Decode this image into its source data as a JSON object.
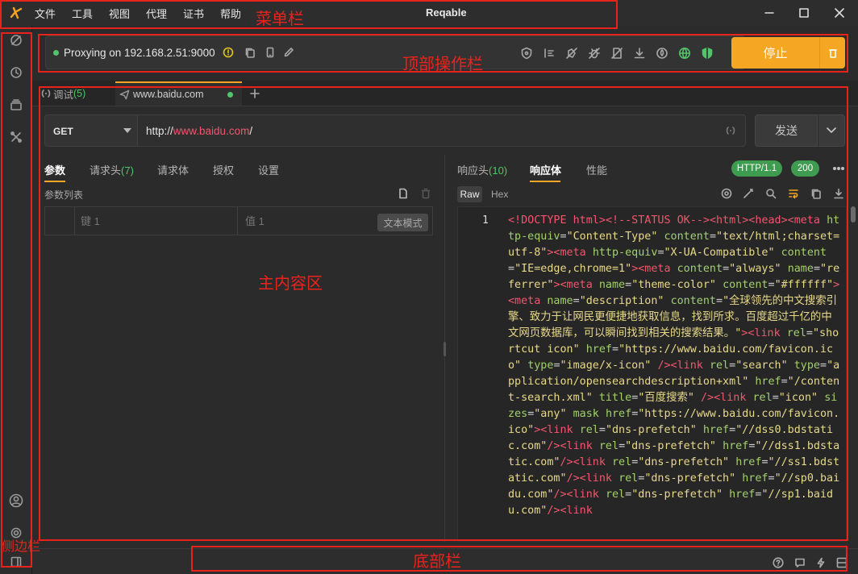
{
  "window": {
    "title": "Reqable",
    "controls": [
      "minimize",
      "maximize",
      "close"
    ]
  },
  "menu": [
    "文件",
    "工具",
    "视图",
    "代理",
    "证书",
    "帮助"
  ],
  "proxy": {
    "status_text": "Proxying on 192.168.2.51:9000",
    "status_color": "#52c46a"
  },
  "toolbar_icons": [
    "shield-icon",
    "breakpoint-icon",
    "no-cache-icon",
    "debug-icon",
    "rewrite-icon",
    "download-icon",
    "script-icon",
    "globe-icon",
    "secure-shield-icon"
  ],
  "stop_button": {
    "label": "停止",
    "color": "#f5a623"
  },
  "tabs": [
    {
      "label": "调试",
      "count": "(5)"
    },
    {
      "label": "www.baidu.com",
      "active": true
    }
  ],
  "request": {
    "method": "GET",
    "url_prefix": "http://",
    "url_host": "www.baidu.com",
    "url_suffix": "/",
    "send_label": "发送"
  },
  "request_tabs": [
    {
      "label": "参数",
      "active": true
    },
    {
      "label": "请求头",
      "count": "(7)"
    },
    {
      "label": "请求体"
    },
    {
      "label": "授权"
    },
    {
      "label": "设置"
    }
  ],
  "params": {
    "title": "参数列表",
    "key_placeholder": "键 1",
    "value_placeholder": "值 1",
    "text_mode_label": "文本模式"
  },
  "response_tabs": [
    {
      "label": "响应头",
      "count": "(10)"
    },
    {
      "label": "响应体",
      "active": true
    },
    {
      "label": "性能"
    }
  ],
  "response_badges": {
    "protocol": "HTTP/1.1",
    "status": "200",
    "color": "#3f9b4f"
  },
  "view_modes": [
    "Raw",
    "Hex"
  ],
  "code": {
    "line_number": "1",
    "segments": [
      [
        "tg",
        "<!DOCTYPE html>"
      ],
      [
        "tg",
        "<!--STATUS OK-->"
      ],
      [
        "tg",
        "<html><head><meta "
      ],
      [
        "at",
        "http-equiv"
      ],
      [
        "",
        "="
      ],
      [
        "st",
        "\"Content-Type\" "
      ],
      [
        "at",
        "content"
      ],
      [
        "",
        "="
      ],
      [
        "st",
        "\"text/html;charset=utf-8\""
      ],
      [
        "tg",
        "><meta "
      ],
      [
        "at",
        "http-equiv"
      ],
      [
        "",
        "="
      ],
      [
        "st",
        "\"X-UA-Compatible\" "
      ],
      [
        "at",
        "content"
      ],
      [
        "",
        "="
      ],
      [
        "st",
        "\"IE=edge,chrome=1\""
      ],
      [
        "tg",
        "><meta "
      ],
      [
        "at",
        "content"
      ],
      [
        "",
        "="
      ],
      [
        "st",
        "\"always\" "
      ],
      [
        "at",
        "name"
      ],
      [
        "",
        "="
      ],
      [
        "st",
        "\"referrer\""
      ],
      [
        "tg",
        "><meta "
      ],
      [
        "at",
        "name"
      ],
      [
        "",
        "="
      ],
      [
        "st",
        "\"theme-color\" "
      ],
      [
        "at",
        "content"
      ],
      [
        "",
        "="
      ],
      [
        "st",
        "\"#ffffff\""
      ],
      [
        "tg",
        "><meta "
      ],
      [
        "at",
        "name"
      ],
      [
        "",
        "="
      ],
      [
        "st",
        "\"description\" "
      ],
      [
        "at",
        "content"
      ],
      [
        "",
        "="
      ],
      [
        "st",
        "\"全球领先的中文搜索引擎、致力于让网民更便捷地获取信息，找到所求。百度超过千亿的中文网页数据库，可以瞬间找到相关的搜索结果。\""
      ],
      [
        "tg",
        "><link "
      ],
      [
        "at",
        "rel"
      ],
      [
        "",
        "="
      ],
      [
        "st",
        "\"shortcut icon\" "
      ],
      [
        "at",
        "href"
      ],
      [
        "",
        "="
      ],
      [
        "st",
        "\"https://www.baidu.com/favicon.ico\" "
      ],
      [
        "at",
        "type"
      ],
      [
        "",
        "="
      ],
      [
        "st",
        "\"image/x-icon\" "
      ],
      [
        "tg",
        "/><link "
      ],
      [
        "at",
        "rel"
      ],
      [
        "",
        "="
      ],
      [
        "st",
        "\"search\" "
      ],
      [
        "at",
        "type"
      ],
      [
        "",
        "="
      ],
      [
        "st",
        "\"application/opensearchdescription+xml\" "
      ],
      [
        "at",
        "href"
      ],
      [
        "",
        "="
      ],
      [
        "st",
        "\"/content-search.xml\" "
      ],
      [
        "at",
        "title"
      ],
      [
        "",
        "="
      ],
      [
        "st",
        "\"百度搜索\" "
      ],
      [
        "tg",
        "/><link "
      ],
      [
        "at",
        "rel"
      ],
      [
        "",
        "="
      ],
      [
        "st",
        "\"icon\" "
      ],
      [
        "at",
        "sizes"
      ],
      [
        "",
        "="
      ],
      [
        "st",
        "\"any\" "
      ],
      [
        "at",
        "mask "
      ],
      [
        "at",
        "href"
      ],
      [
        "",
        "="
      ],
      [
        "st",
        "\"https://www.baidu.com/favicon.ico\""
      ],
      [
        "tg",
        "><link "
      ],
      [
        "at",
        "rel"
      ],
      [
        "",
        "="
      ],
      [
        "st",
        "\"dns-prefetch\" "
      ],
      [
        "at",
        "href"
      ],
      [
        "",
        "="
      ],
      [
        "st",
        "\"//dss0.bdstatic.com\""
      ],
      [
        "tg",
        "/><link "
      ],
      [
        "at",
        "rel"
      ],
      [
        "",
        "="
      ],
      [
        "st",
        "\"dns-prefetch\" "
      ],
      [
        "at",
        "href"
      ],
      [
        "",
        "="
      ],
      [
        "st",
        "\"//dss1.bdstatic.com\""
      ],
      [
        "tg",
        "/><link "
      ],
      [
        "at",
        "rel"
      ],
      [
        "",
        "="
      ],
      [
        "st",
        "\"dns-prefetch\" "
      ],
      [
        "at",
        "href"
      ],
      [
        "",
        "="
      ],
      [
        "st",
        "\"//ss1.bdstatic.com\""
      ],
      [
        "tg",
        "/><link "
      ],
      [
        "at",
        "rel"
      ],
      [
        "",
        "="
      ],
      [
        "st",
        "\"dns-prefetch\" "
      ],
      [
        "at",
        "href"
      ],
      [
        "",
        "="
      ],
      [
        "st",
        "\"//sp0.baidu.com\""
      ],
      [
        "tg",
        "/><link "
      ],
      [
        "at",
        "rel"
      ],
      [
        "",
        "="
      ],
      [
        "st",
        "\"dns-prefetch\" "
      ],
      [
        "at",
        "href"
      ],
      [
        "",
        "="
      ],
      [
        "st",
        "\"//sp1.baidu.com\""
      ],
      [
        "tg",
        "/><link"
      ]
    ]
  },
  "annotations": {
    "menu_bar": "菜单栏",
    "top_bar": "顶部操作栏",
    "main_content": "主内容区",
    "sidebar": "侧边栏",
    "bottom_bar": "底部栏"
  }
}
